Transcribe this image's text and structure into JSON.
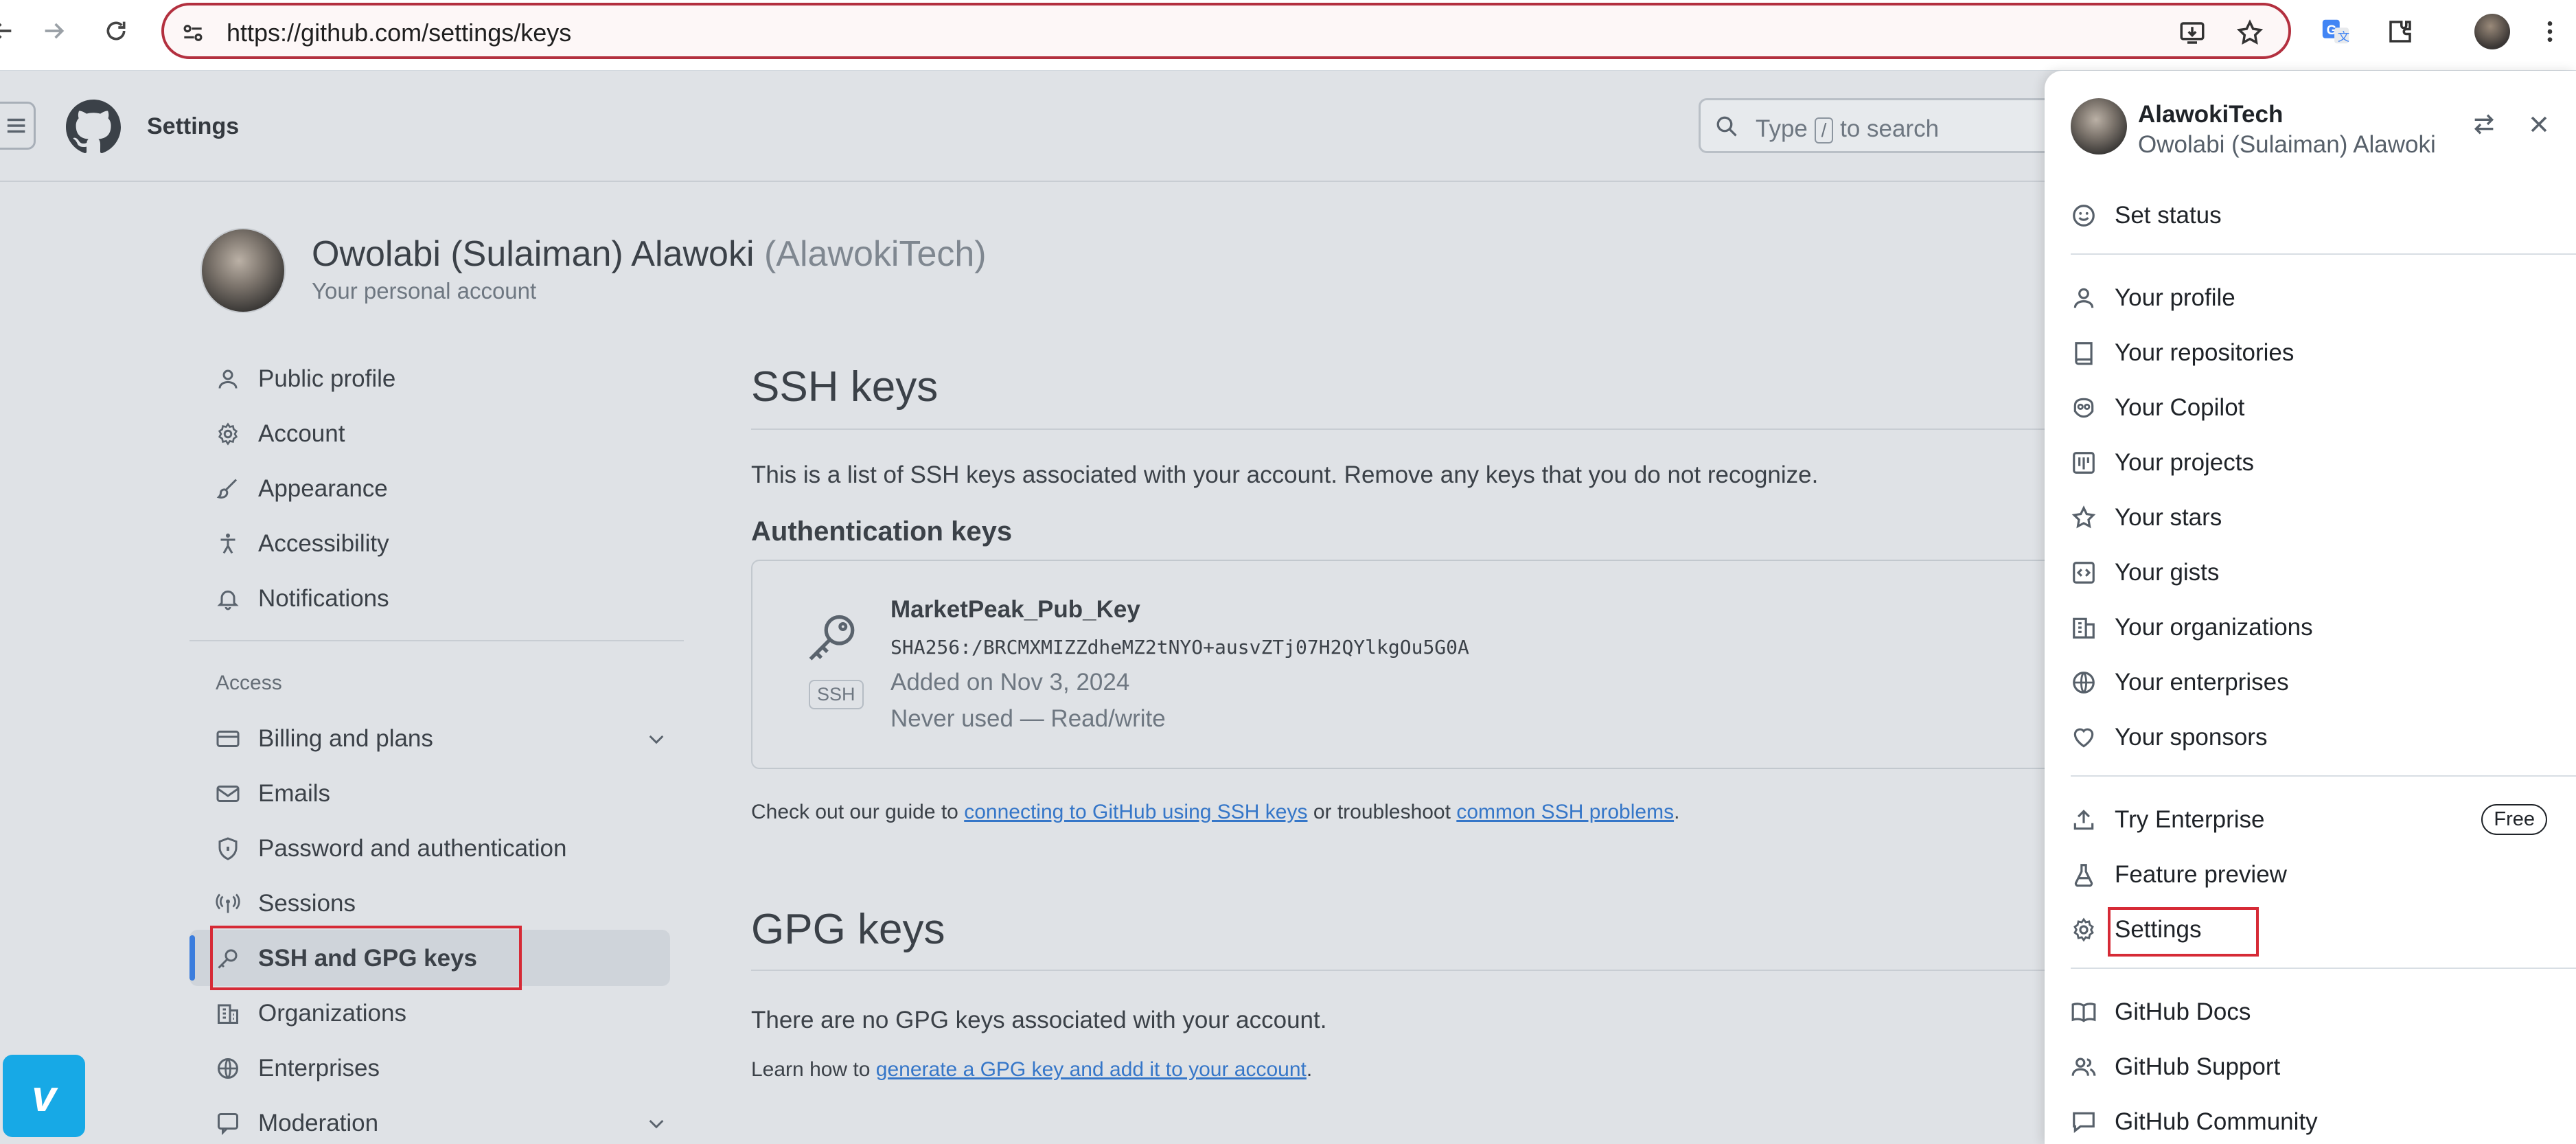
{
  "browser": {
    "url": "https://github.com/settings/keys"
  },
  "header": {
    "title": "Settings",
    "search_prefix": "Type",
    "search_key": "/",
    "search_suffix": "to search"
  },
  "profile": {
    "name": "Owolabi (Sulaiman) Alawoki",
    "handle": "(AlawokiTech)",
    "subtitle": "Your personal account"
  },
  "sidebar": {
    "items": [
      {
        "label": "Public profile",
        "icon": "person-icon"
      },
      {
        "label": "Account",
        "icon": "gear-icon"
      },
      {
        "label": "Appearance",
        "icon": "paintbrush-icon"
      },
      {
        "label": "Accessibility",
        "icon": "accessibility-icon"
      },
      {
        "label": "Notifications",
        "icon": "bell-icon"
      }
    ],
    "access_label": "Access",
    "access_items": [
      {
        "label": "Billing and plans",
        "icon": "credit-card-icon"
      },
      {
        "label": "Emails",
        "icon": "mail-icon"
      },
      {
        "label": "Password and authentication",
        "icon": "shield-lock-icon"
      },
      {
        "label": "Sessions",
        "icon": "broadcast-icon"
      },
      {
        "label": "SSH and GPG keys",
        "icon": "key-icon"
      },
      {
        "label": "Organizations",
        "icon": "organization-icon"
      },
      {
        "label": "Enterprises",
        "icon": "globe-icon"
      },
      {
        "label": "Moderation",
        "icon": "report-icon"
      }
    ]
  },
  "main": {
    "ssh_heading": "SSH keys",
    "ssh_description": "This is a list of SSH keys associated with your account. Remove any keys that you do not recognize.",
    "auth_heading": "Authentication keys",
    "key": {
      "title": "MarketPeak_Pub_Key",
      "fingerprint": "SHA256:/BRCMXMIZZdheMZ2tNYO+ausvZTj07H2QYlkgOu5G0A",
      "added": "Added on Nov 3, 2024",
      "usage": "Never used — Read/write",
      "badge": "SSH"
    },
    "guide_prefix": "Check out our guide to",
    "guide_link1": "connecting to GitHub using SSH keys",
    "guide_middle": "or troubleshoot",
    "guide_link2": "common SSH problems",
    "guide_suffix": ".",
    "gpg_heading": "GPG keys",
    "gpg_empty": "There are no GPG keys associated with your account.",
    "learn_prefix": "Learn how to",
    "learn_link": "generate a GPG key and add it to your account",
    "learn_suffix": "."
  },
  "panel": {
    "username": "AlawokiTech",
    "full_name": "Owolabi (Sulaiman) Alawoki",
    "set_status": "Set status",
    "group1": [
      {
        "label": "Your profile",
        "icon": "person-icon"
      },
      {
        "label": "Your repositories",
        "icon": "repo-icon"
      },
      {
        "label": "Your Copilot",
        "icon": "copilot-icon"
      },
      {
        "label": "Your projects",
        "icon": "project-icon"
      },
      {
        "label": "Your stars",
        "icon": "star-icon"
      },
      {
        "label": "Your gists",
        "icon": "code-square-icon"
      },
      {
        "label": "Your organizations",
        "icon": "organization-icon"
      },
      {
        "label": "Your enterprises",
        "icon": "globe-icon"
      },
      {
        "label": "Your sponsors",
        "icon": "heart-icon"
      }
    ],
    "group2": [
      {
        "label": "Try Enterprise",
        "icon": "upload-icon"
      },
      {
        "label": "Feature preview",
        "icon": "beaker-icon"
      },
      {
        "label": "Settings",
        "icon": "gear-icon"
      }
    ],
    "free_badge": "Free",
    "group3": [
      {
        "label": "GitHub Docs",
        "icon": "book-icon"
      },
      {
        "label": "GitHub Support",
        "icon": "people-icon"
      },
      {
        "label": "GitHub Community",
        "icon": "comment-icon"
      }
    ]
  },
  "colors": {
    "accent": "#3b7ddd",
    "highlight": "#d62a36",
    "vimeo": "#17a9e6"
  },
  "vimeo_label": "v"
}
